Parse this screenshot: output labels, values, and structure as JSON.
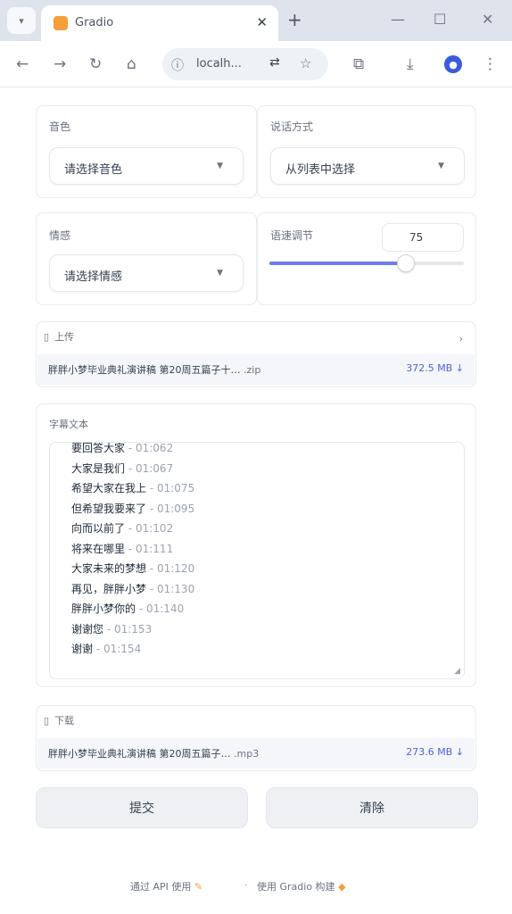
{
  "browser": {
    "tab_title": "Gradio",
    "url": "localh...",
    "tab_close": "✕",
    "new_tab": "+",
    "minimize": "—",
    "maximize": "☐",
    "close": "✕"
  },
  "form": {
    "voice_label": "音色",
    "voice_value": "请选择音色",
    "style_label": "说话方式",
    "style_value": "从列表中选择",
    "emotion_label": "情感",
    "emotion_value": "请选择情感",
    "speed_label": "语速调节",
    "speed_value": "75",
    "speed_fraction": 0.7
  },
  "upload": {
    "label": "上传",
    "file_name": "胖胖小梦毕业典礼演讲稿 第20周五篇子十…",
    "file_ext": ".zip",
    "file_size": "372.5 MB ↓"
  },
  "subtitles": {
    "label": "字幕文本",
    "lines": [
      {
        "text": "要回答大家",
        "time": "- 01:062"
      },
      {
        "text": "大家是我们",
        "time": "- 01:067"
      },
      {
        "text": "希望大家在我上",
        "time": "- 01:075"
      },
      {
        "text": "但希望我要来了",
        "time": "- 01:095"
      },
      {
        "text": "向而以前了",
        "time": "- 01:102"
      },
      {
        "text": "将来在哪里",
        "time": "- 01:111"
      },
      {
        "text": "大家未来的梦想",
        "time": "- 01:120"
      },
      {
        "text": "再见，胖胖小梦",
        "time": "- 01:130"
      },
      {
        "text": "胖胖小梦你的",
        "time": "- 01:140"
      },
      {
        "text": "谢谢您",
        "time": "- 01:153"
      },
      {
        "text": "谢谢",
        "time": "- 01:154"
      }
    ]
  },
  "download": {
    "label": "下载",
    "file_name": "胖胖小梦毕业典礼演讲稿 第20周五篇子…",
    "file_ext": ".mp3",
    "file_size": "273.6 MB ↓"
  },
  "buttons": {
    "submit": "提交",
    "clear": "清除"
  },
  "footer": {
    "api_text": "通过 API 使用",
    "built_text": "使用 Gradio 构建"
  }
}
